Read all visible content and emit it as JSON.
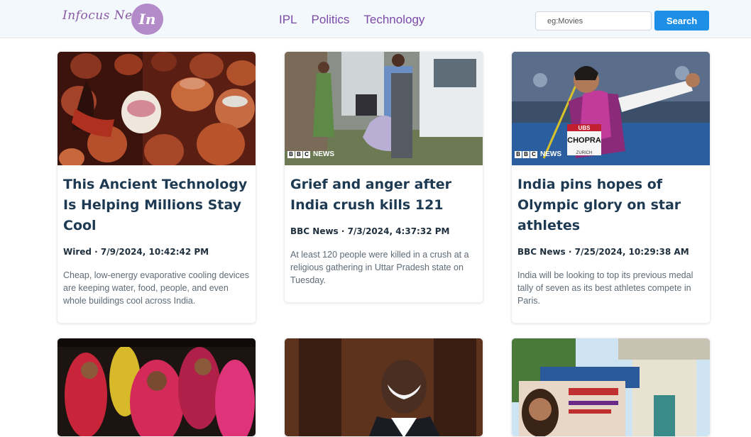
{
  "header": {
    "logo_text": "Infocus News",
    "logo_badge": "In",
    "nav": [
      "IPL",
      "Politics",
      "Technology"
    ],
    "search_placeholder": "eg:Movies",
    "search_button": "Search"
  },
  "articles": [
    {
      "title": "This Ancient Technology Is Helping Millions Stay Cool",
      "meta": "Wired · 7/9/2024, 10:42:42 PM",
      "description": "Cheap, low-energy evaporative cooling devices are keeping water, food, people, and even whole buildings cool across India.",
      "image": "terracotta-pots-image"
    },
    {
      "title": "Grief and anger after India crush kills 121",
      "meta": "BBC News · 7/3/2024, 4:37:32 PM",
      "description": "At least 120 people were killed in a crush at a religious gathering in Uttar Pradesh state on Tuesday.",
      "image": "grieving-people-image",
      "badge": "NEWS"
    },
    {
      "title": "India pins hopes of Olympic glory on star athletes",
      "meta": "BBC News · 7/25/2024, 10:29:38 AM",
      "description": "India will be looking to top its previous medal tally of seven as its best athletes compete in Paris.",
      "image": "javelin-athlete-image",
      "badge": "NEWS",
      "bib_top": "UBS",
      "bib_name": "CHOPRA",
      "bib_city": "ZURICH"
    },
    {
      "image": "women-in-sarees-image"
    },
    {
      "image": "smiling-man-image"
    },
    {
      "image": "temple-poster-image"
    }
  ]
}
